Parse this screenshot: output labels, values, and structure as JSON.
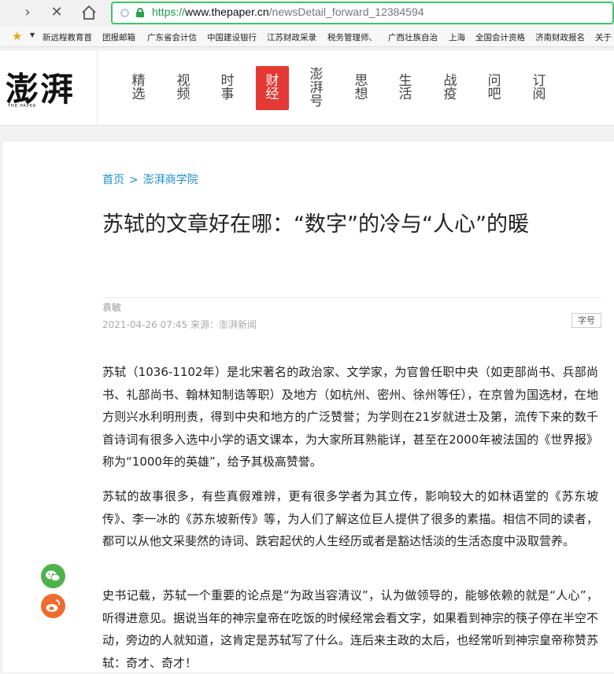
{
  "browser": {
    "url_scheme": "https://",
    "url_host": "www.thepaper.cn",
    "url_path": "/newsDetail_forward_12384594",
    "bookmarks": [
      "新远程教育首",
      "团报邮箱",
      "广东省会计信",
      "中国建设银行",
      "江苏财政采录",
      "税务管理师、",
      "广西壮族自治",
      "上海",
      "全国会计资格",
      "济南财政报名",
      "关于"
    ]
  },
  "site": {
    "logo_text": "澎湃",
    "logo_sub": "THE PAPER",
    "nav": [
      {
        "label": "精\n选",
        "active": false
      },
      {
        "label": "视\n频",
        "active": false
      },
      {
        "label": "时\n事",
        "active": false
      },
      {
        "label": "财\n经",
        "active": true
      },
      {
        "label": "澎\n湃\n号",
        "active": false
      },
      {
        "label": "思\n想",
        "active": false
      },
      {
        "label": "生\n活",
        "active": false
      },
      {
        "label": "战\n疫",
        "active": false
      },
      {
        "label": "问\n吧",
        "active": false
      },
      {
        "label": "订\n阅",
        "active": false
      }
    ]
  },
  "article": {
    "breadcrumb": {
      "home": "首页",
      "separator": ">",
      "section": "澎湃商学院"
    },
    "title": "苏轼的文章好在哪：“数字”的冷与“人心”的暖",
    "author": "袁敏",
    "meta": "2021-04-26 07:45 来源：澎湃新闻",
    "font_button": "字号",
    "paragraphs": [
      "苏轼（1036-1102年）是北宋著名的政治家、文学家，为官曾任职中央（如吏部尚书、兵部尚书、礼部尚书、翰林知制诰等职）及地方（如杭州、密州、徐州等任），在京曾为国选材，在地方则兴水利明刑责，得到中央和地方的广泛赞誉；为学则在21岁就进士及第，流传下来的数千首诗词有很多入选中小学的语文课本，为大家所耳熟能详，甚至在2000年被法国的《世界报》称为“1000年的英雄”，给予其极高赞誉。",
      "苏轼的故事很多，有些真假难辨，更有很多学者为其立传，影响较大的如林语堂的《苏东坡传》、李一冰的《苏东坡新传》等，为人们了解这位巨人提供了很多的素描。相信不同的读者，都可以从他文采斐然的诗词、跌宕起伏的人生经历或者是豁达恬淡的生活态度中汲取营养。",
      "史书记载，苏轼一个重要的论点是“为政当容清议”，认为做领导的，能够依赖的就是“人心”，听得进意见。据说当年的神宗皇帝在吃饭的时候经常会看文字，如果看到神宗的筷子停在半空不动，旁边的人就知道，这肯定是苏轼写了什么。连后来主政的太后，也经常听到神宗皇帝称赞苏轼：奇才、奇才！"
    ]
  },
  "share": {
    "wechat_icon": "wechat-icon",
    "weibo_icon": "weibo-icon",
    "wechat_color": "#4bb34a",
    "weibo_color": "#ef6b2c"
  }
}
